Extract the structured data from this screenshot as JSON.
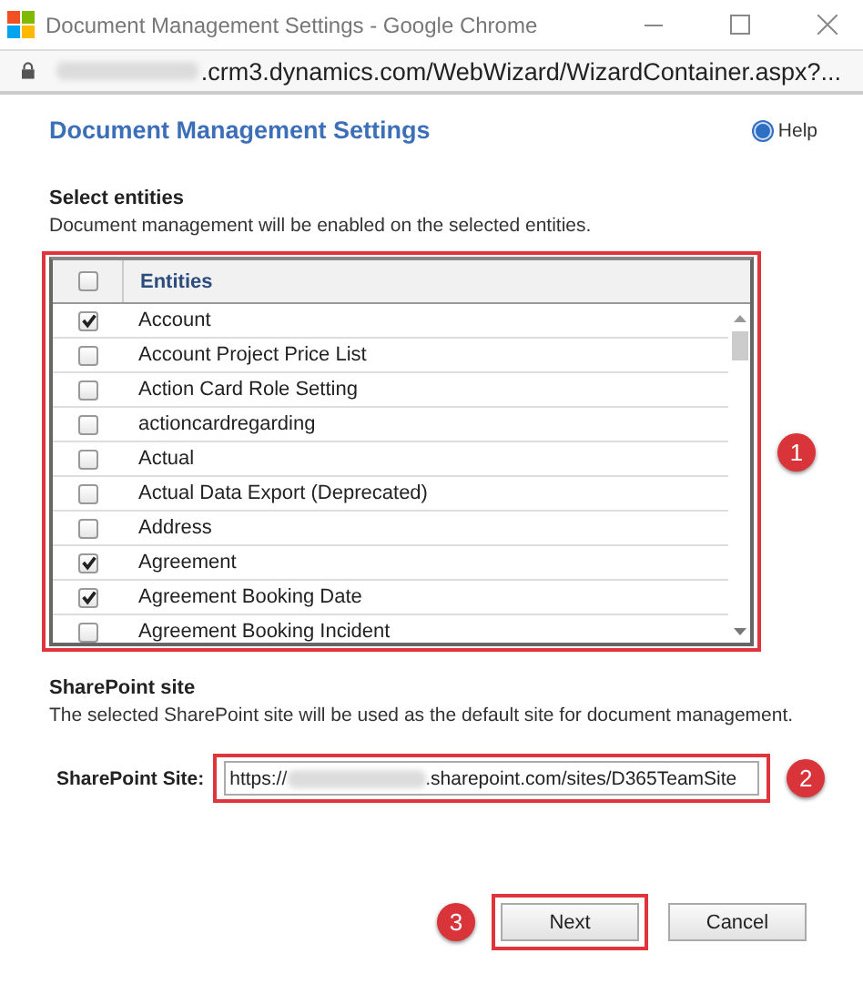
{
  "window": {
    "title": "Document Management Settings - Google Chrome"
  },
  "address_bar": {
    "url": ".crm3.dynamics.com/WebWizard/WizardContainer.aspx?..."
  },
  "heading": "Document Management Settings",
  "help": "Help",
  "entities_section": {
    "title": "Select entities",
    "description": "Document management will be enabled on the selected entities.",
    "header_checked": false,
    "column": "Entities",
    "badge": "1",
    "rows": [
      {
        "name": "Account",
        "checked": true
      },
      {
        "name": "Account Project Price List",
        "checked": false
      },
      {
        "name": "Action Card Role Setting",
        "checked": false
      },
      {
        "name": "actioncardregarding",
        "checked": false
      },
      {
        "name": "Actual",
        "checked": false
      },
      {
        "name": "Actual Data Export (Deprecated)",
        "checked": false
      },
      {
        "name": "Address",
        "checked": false
      },
      {
        "name": "Agreement",
        "checked": true
      },
      {
        "name": "Agreement Booking Date",
        "checked": true
      },
      {
        "name": "Agreement Booking Incident",
        "checked": false
      }
    ]
  },
  "sharepoint_section": {
    "title": "SharePoint site",
    "description": "The selected SharePoint site will be used as the default site for document management.",
    "label": "SharePoint Site:",
    "value_start": "https://",
    "value_end": ".sharepoint.com/sites/D365TeamSite",
    "badge": "2"
  },
  "buttons": [
    {
      "label": "Next",
      "highlighted": true,
      "badge": "3"
    },
    {
      "label": "Cancel",
      "highlighted": false
    }
  ]
}
